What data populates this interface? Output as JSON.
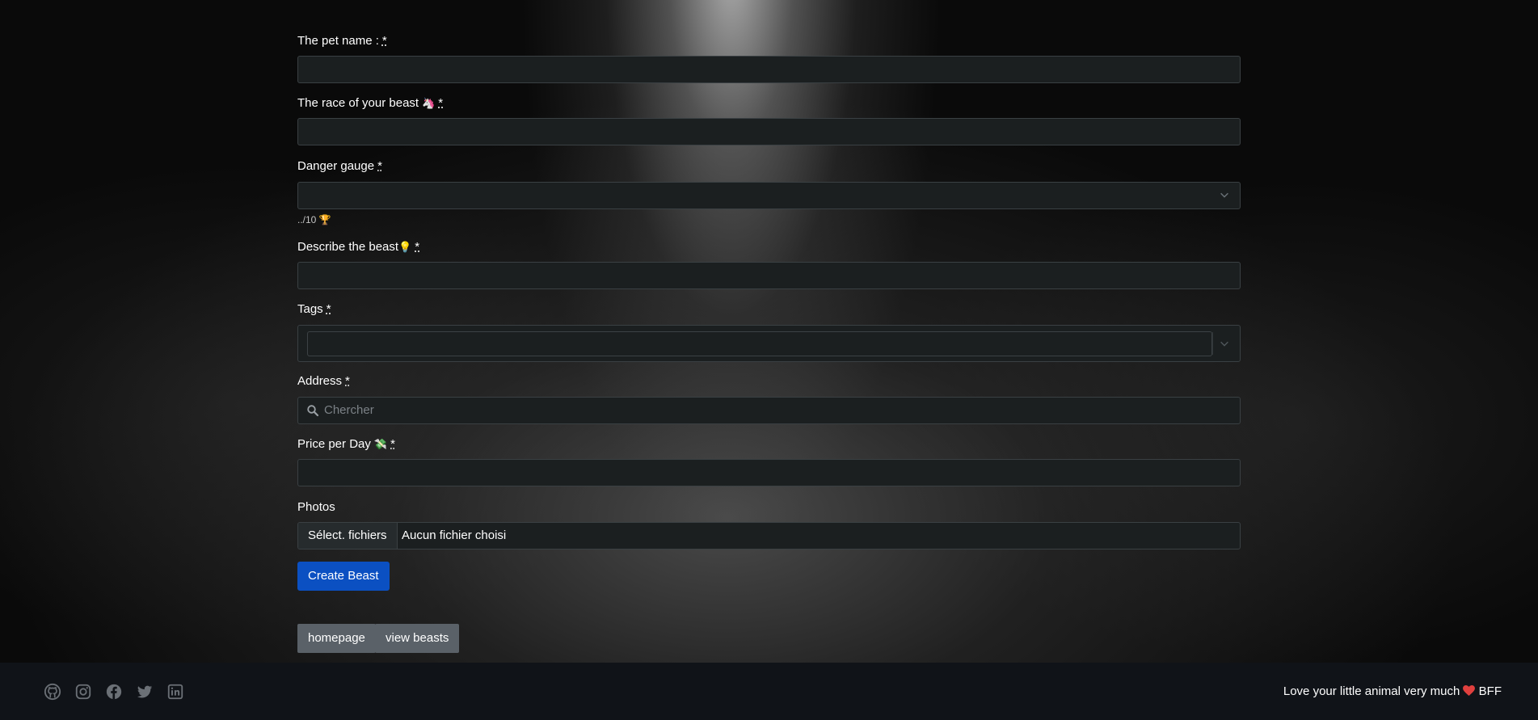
{
  "form": {
    "pet_name": {
      "label": "The pet name :",
      "required_mark": "*",
      "value": ""
    },
    "race": {
      "label": "The race of your beast",
      "emoji": "🦄",
      "required_mark": "*",
      "value": ""
    },
    "danger": {
      "label": "Danger gauge",
      "required_mark": "*",
      "selected": "",
      "hint": "../10 🏆"
    },
    "describe": {
      "label": "Describe the beast",
      "emoji": "💡",
      "required_mark": "*",
      "value": ""
    },
    "tags": {
      "label": "Tags",
      "required_mark": "*"
    },
    "address": {
      "label": "Address",
      "required_mark": "*",
      "placeholder": "Chercher"
    },
    "price": {
      "label": "Price per Day",
      "emoji": "💸",
      "required_mark": "*",
      "value": ""
    },
    "photos": {
      "label": "Photos",
      "button_label": "Sélect. fichiers",
      "status": "Aucun fichier choisi"
    },
    "submit_label": "Create Beast"
  },
  "nav": {
    "homepage_label": "homepage",
    "view_beasts_label": "view beasts"
  },
  "footer": {
    "social_icons": [
      "github-icon",
      "instagram-icon",
      "facebook-icon",
      "twitter-icon",
      "linkedin-icon"
    ],
    "tagline_prefix": "Love your little animal very much",
    "heart": "❤️",
    "tagline_suffix": "BFF"
  },
  "colors": {
    "primary_button": "#0b50c2",
    "secondary_button": "#5a6168",
    "input_bg": "#1b1f20",
    "footer_bg": "#101318",
    "heart": "#e0403e"
  }
}
